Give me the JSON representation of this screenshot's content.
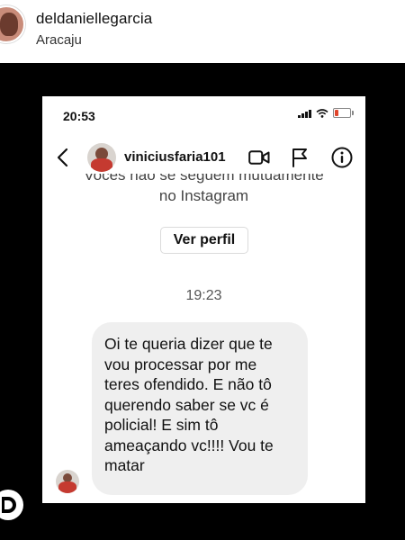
{
  "post": {
    "username": "deldaniellegarcia",
    "location": "Aracaju"
  },
  "phone": {
    "time": "20:53"
  },
  "dm": {
    "username": "viniciusfaria101",
    "mutual_line1": "Vocês não se seguem mutuamente",
    "mutual_line2": "no Instagram",
    "view_profile": "Ver perfil",
    "timestamp": "19:23",
    "message": "Oi te queria dizer que te\nvou processar por me\nteres ofendido. E não tô\nquerendo saber se vc é\npolicial! E sim tô\nameaçando vc!!!!  Vou te\nmatar"
  },
  "icons": {
    "back": "chevron-left-icon",
    "video": "video-camera-icon",
    "flag": "flag-icon",
    "info": "info-icon",
    "watermark": "logo-icon"
  },
  "colors": {
    "background": "#000000",
    "bubble": "#efefef",
    "battery_low": "#e0452b"
  }
}
